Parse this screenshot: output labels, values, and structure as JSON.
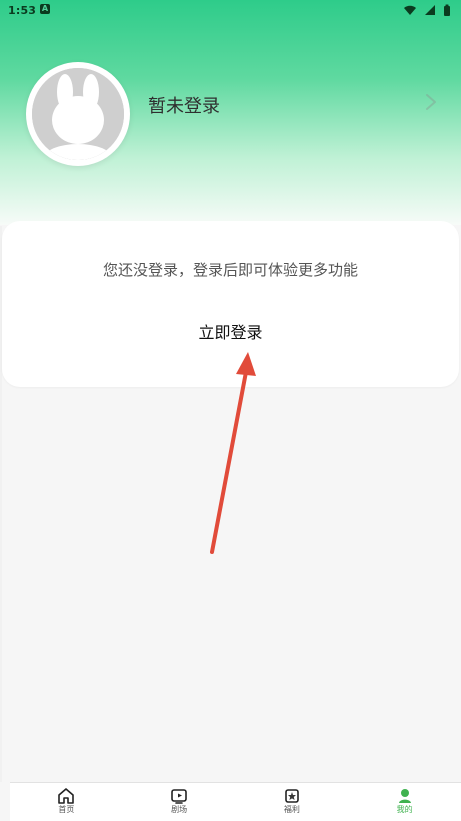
{
  "status_bar": {
    "time": "1:53",
    "left_icon": "A"
  },
  "profile": {
    "login_status": "暂未登录",
    "avatar_icon": "rabbit-avatar-icon",
    "chevron_icon": "chevron-right-icon"
  },
  "card": {
    "message": "您还没登录，登录后即可体验更多功能",
    "login_button": "立即登录"
  },
  "bottom_nav": {
    "items": [
      {
        "label": "首页",
        "icon": "home-icon",
        "active": false
      },
      {
        "label": "剧场",
        "icon": "play-icon",
        "active": false
      },
      {
        "label": "福利",
        "icon": "gift-icon",
        "active": false
      },
      {
        "label": "我的",
        "icon": "user-icon",
        "active": true
      }
    ]
  },
  "colors": {
    "accent": "#3FB24F",
    "header_top": "#2ECC8A",
    "arrow": "#E14B3A"
  }
}
